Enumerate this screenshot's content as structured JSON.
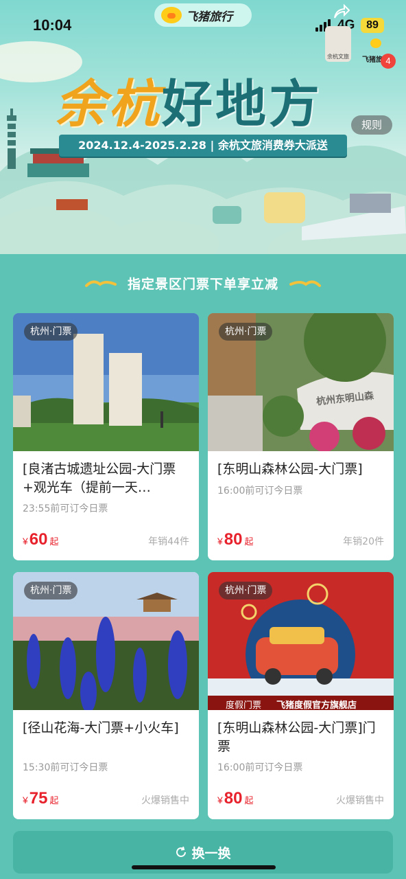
{
  "status_bar": {
    "time": "10:04",
    "network": "4G",
    "battery": "89"
  },
  "app_pill": {
    "name": "飞猪旅行"
  },
  "banner": {
    "title_part1": "余杭",
    "title_part2": "好地方",
    "date_text": "2024.12.4-2025.2.28 | 余杭文旅消费券大派送",
    "rules_label": "规则",
    "logo_text": "余杭文旅",
    "brand_small": "飞猪旅行",
    "notification_count": "4"
  },
  "section": {
    "title": "指定景区门票下单享立减"
  },
  "cards": [
    {
      "tag": "杭州·门票",
      "title": "[良渚古城遗址公园-大门票+观光车（提前一天…",
      "subtitle": "23:55前可订今日票",
      "currency": "¥",
      "price": "60",
      "price_suffix": "起",
      "sales": "年销44件"
    },
    {
      "tag": "杭州·门票",
      "title": "[东明山森林公园-大门票]",
      "subtitle": "16:00前可订今日票",
      "currency": "¥",
      "price": "80",
      "price_suffix": "起",
      "sales": "年销20件",
      "image_text": "杭州东明山森"
    },
    {
      "tag": "杭州·门票",
      "title": "[径山花海-大门票+小火车]",
      "subtitle": "15:30前可订今日票",
      "currency": "¥",
      "price": "75",
      "price_suffix": "起",
      "sales": "火爆销售中"
    },
    {
      "tag": "杭州·门票",
      "title": "[东明山森林公园-大门票]门票",
      "subtitle": "16:00前可订今日票",
      "currency": "¥",
      "price": "80",
      "price_suffix": "起",
      "sales": "火爆销售中",
      "image_left": "度假门票",
      "image_right": "飞猪度假官方旗舰店"
    }
  ],
  "refresh_button": {
    "label": "换一换"
  },
  "colors": {
    "background": "#5dc3b4",
    "price": "#e8222c",
    "refresh": "#47b4a4"
  }
}
